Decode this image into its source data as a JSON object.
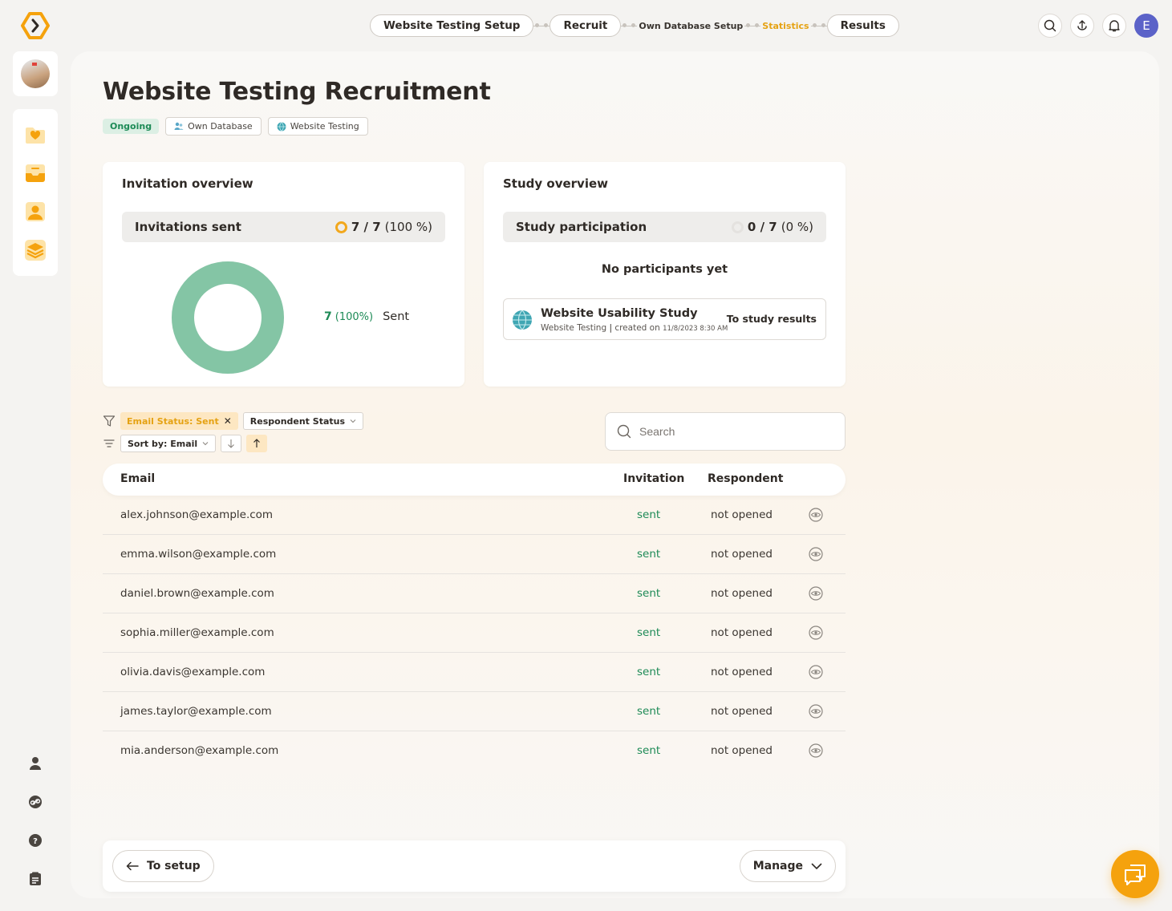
{
  "stepper": {
    "steps": [
      {
        "label": "Website Testing Setup"
      },
      {
        "label": "Recruit"
      },
      {
        "label": "Own Database Setup"
      },
      {
        "label": "Statistics"
      },
      {
        "label": "Results"
      }
    ]
  },
  "user": {
    "initial": "E"
  },
  "page": {
    "title": "Website Testing Recruitment",
    "status": "Ongoing",
    "tags": [
      "Own Database",
      "Website Testing"
    ]
  },
  "invitation_overview": {
    "title": "Invitation overview",
    "stat_label": "Invitations sent",
    "stat_fraction": "7 / 7",
    "stat_percent": "(100 %)",
    "legend_count": "7",
    "legend_percent": "(100%)",
    "legend_label": "Sent",
    "sent_fraction": 1.0
  },
  "study_overview": {
    "title": "Study overview",
    "stat_label": "Study participation",
    "stat_fraction": "0 / 7",
    "stat_percent": "(0 %)",
    "empty_message": "No participants yet",
    "study": {
      "name": "Website Usability Study",
      "type": "Website Testing",
      "created_prefix": "created on",
      "created_date": "11/8/2023 8:30 AM",
      "link_label": "To study results"
    }
  },
  "filters": {
    "active_filter": "Email Status: Sent",
    "respondent_filter": "Respondent Status",
    "sort_label": "Sort by: Email"
  },
  "search": {
    "placeholder": "Search"
  },
  "table": {
    "headers": {
      "email": "Email",
      "invitation": "Invitation",
      "respondent": "Respondent"
    },
    "rows": [
      {
        "email": "alex.johnson@example.com",
        "invitation": "sent",
        "respondent": "not opened"
      },
      {
        "email": "emma.wilson@example.com",
        "invitation": "sent",
        "respondent": "not opened"
      },
      {
        "email": "daniel.brown@example.com",
        "invitation": "sent",
        "respondent": "not opened"
      },
      {
        "email": "sophia.miller@example.com",
        "invitation": "sent",
        "respondent": "not opened"
      },
      {
        "email": "olivia.davis@example.com",
        "invitation": "sent",
        "respondent": "not opened"
      },
      {
        "email": "james.taylor@example.com",
        "invitation": "sent",
        "respondent": "not opened"
      },
      {
        "email": "mia.anderson@example.com",
        "invitation": "sent",
        "respondent": "not opened"
      }
    ]
  },
  "footer": {
    "back_label": "To setup",
    "manage_label": "Manage"
  },
  "colors": {
    "accent": "#f5a20d",
    "success": "#1d8a56",
    "donut": "#84c5a5",
    "avatar": "#5b62c8"
  }
}
